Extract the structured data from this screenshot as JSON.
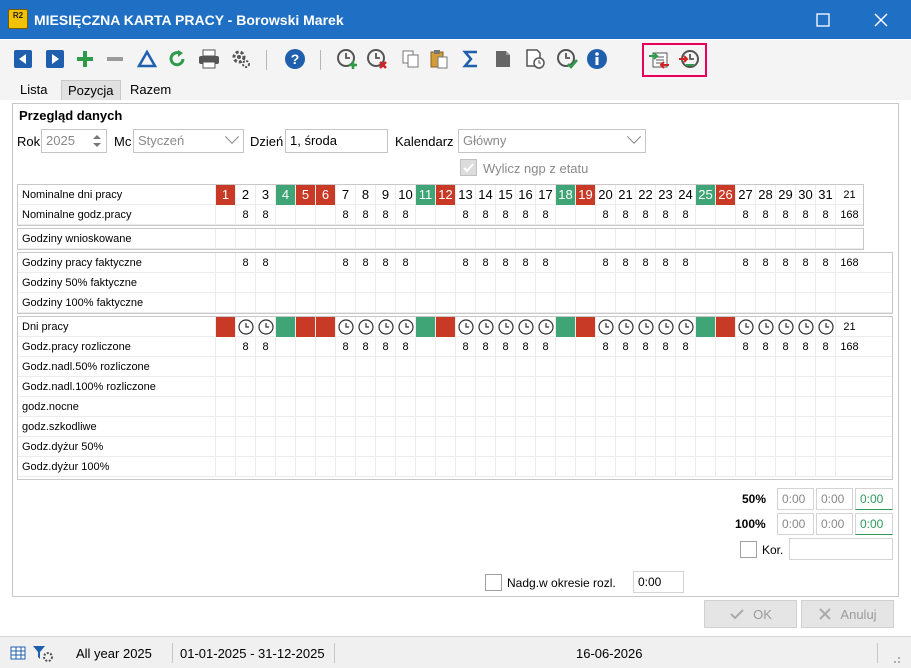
{
  "window": {
    "title": "MIESIĘCZNA KARTA PRACY - Borowski Marek",
    "app_badge": "R2"
  },
  "colors": {
    "titlebar": "#1f6fc4",
    "red": "#c93a26",
    "green": "#3fa576",
    "highlight": "#e8005a",
    "accent_green": "#2f9a5a"
  },
  "toolbar": {
    "icons": [
      "nav-left-icon",
      "nav-right-icon",
      "add-icon",
      "remove-icon",
      "warning-triangle-icon",
      "refresh-icon",
      "print-icon",
      "settings-gear-icon",
      "help-icon",
      "clock-add-icon",
      "clock-delete-icon",
      "copy-icon",
      "paste-icon",
      "sum-icon",
      "document-icon",
      "calendar-clock-icon",
      "clock-check-icon",
      "info-icon",
      "transfer-add-icon",
      "transfer-back-icon"
    ]
  },
  "tabs": [
    {
      "label": "Lista"
    },
    {
      "label": "Pozycja",
      "active": true
    },
    {
      "label": "Razem"
    }
  ],
  "section_title": "Przegląd danych",
  "form": {
    "rok_label": "Rok",
    "rok_value": "2025",
    "mc_label": "Mc",
    "mc_value": "Styczeń",
    "dzien_label": "Dzień",
    "dzien_value": "1, środa",
    "kalendarz_label": "Kalendarz",
    "kalendarz_value": "Główny",
    "wylicz_label": "Wylicz ngp z etatu"
  },
  "days": [
    1,
    2,
    3,
    4,
    5,
    6,
    7,
    8,
    9,
    10,
    11,
    12,
    13,
    14,
    15,
    16,
    17,
    18,
    19,
    20,
    21,
    22,
    23,
    24,
    25,
    26,
    27,
    28,
    29,
    30,
    31
  ],
  "day_types": [
    "red",
    "work",
    "work",
    "green",
    "red",
    "red",
    "work",
    "work",
    "work",
    "work",
    "green",
    "red",
    "work",
    "work",
    "work",
    "work",
    "work",
    "green",
    "red",
    "work",
    "work",
    "work",
    "work",
    "work",
    "green",
    "red",
    "work",
    "work",
    "work",
    "work",
    "work"
  ],
  "grid1": {
    "rows": [
      {
        "label": "Nominalne dni pracy",
        "kind": "days",
        "total": "21"
      },
      {
        "label": "Nominalne godz.pracy",
        "kind": "hours",
        "total": "168"
      }
    ]
  },
  "grid2": {
    "rows": [
      {
        "label": "Godziny wnioskowane"
      }
    ]
  },
  "grid3": {
    "rows": [
      {
        "label": "Godziny pracy faktyczne",
        "kind": "hours",
        "total": "168"
      },
      {
        "label": "Godziny 50% faktyczne"
      },
      {
        "label": "Godziny 100% faktyczne"
      }
    ]
  },
  "grid4": {
    "rows": [
      {
        "label": "Dni pracy",
        "kind": "blocks",
        "total": "21"
      },
      {
        "label": "Godz.pracy rozliczone",
        "kind": "hours",
        "total": "168"
      },
      {
        "label": "Godz.nadl.50% rozliczone"
      },
      {
        "label": "Godz.nadl.100% rozliczone"
      },
      {
        "label": "godz.nocne"
      },
      {
        "label": "godz.szkodliwe"
      },
      {
        "label": "Godz.dyżur 50%"
      },
      {
        "label": "Godz.dyżur 100%"
      }
    ]
  },
  "hour_value": "8",
  "totals": {
    "p50_label": "50%",
    "p50": [
      "0:00",
      "0:00",
      "0:00"
    ],
    "p100_label": "100%",
    "p100": [
      "0:00",
      "0:00",
      "0:00"
    ],
    "kor_label": "Kor.",
    "kor_value": ""
  },
  "nadg": {
    "label": "Nadg.w okresie rozl.",
    "value": "0:00"
  },
  "buttons": {
    "ok": "OK",
    "cancel": "Anuluj"
  },
  "status": {
    "period_label": "All year 2025",
    "range": "01-01-2025 - 31-12-2025",
    "date": "16-06-2026"
  }
}
